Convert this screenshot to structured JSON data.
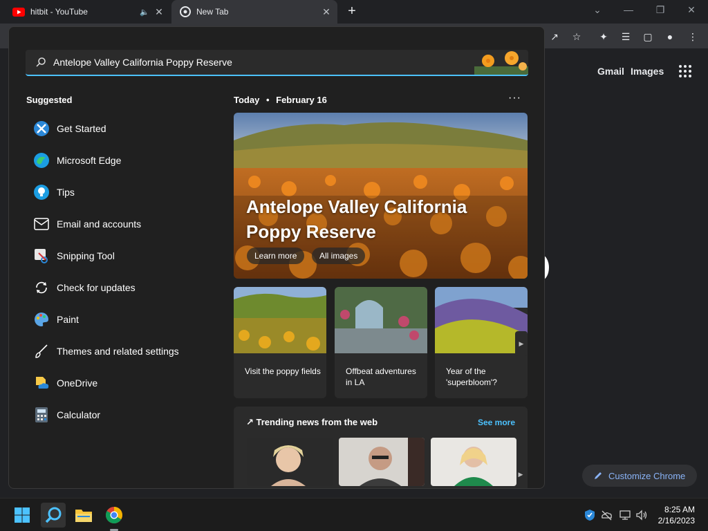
{
  "browser": {
    "tabs": [
      {
        "title": "hitbit - YouTube",
        "icon": "youtube-icon",
        "audio": true
      },
      {
        "title": "New Tab",
        "icon": "chrome-icon"
      }
    ],
    "new_tab_symbol": "+",
    "close_symbol": "✕"
  },
  "google": {
    "gmail": "Gmail",
    "images": "Images",
    "customize": "Customize Chrome"
  },
  "search": {
    "query": "Antelope Valley California Poppy Reserve"
  },
  "suggested": {
    "title": "Suggested",
    "items": [
      {
        "label": "Get Started",
        "icon": "get-started-icon"
      },
      {
        "label": "Microsoft Edge",
        "icon": "edge-icon"
      },
      {
        "label": "Tips",
        "icon": "tips-icon"
      },
      {
        "label": "Email and accounts",
        "icon": "email-icon"
      },
      {
        "label": "Snipping Tool",
        "icon": "snipping-tool-icon"
      },
      {
        "label": "Check for updates",
        "icon": "update-icon"
      },
      {
        "label": "Paint",
        "icon": "paint-icon"
      },
      {
        "label": "Themes and related settings",
        "icon": "brush-icon"
      },
      {
        "label": "OneDrive",
        "icon": "onedrive-icon"
      },
      {
        "label": "Calculator",
        "icon": "calculator-icon"
      }
    ]
  },
  "today": {
    "label": "Today",
    "separator": "•",
    "date": "February 16",
    "more": "···",
    "hero": {
      "title": "Antelope Valley California Poppy Reserve",
      "learn_more": "Learn more",
      "all_images": "All images"
    },
    "cards": [
      {
        "caption": "Visit the poppy fields"
      },
      {
        "caption": "Offbeat adventures in LA"
      },
      {
        "caption": "Year of the 'superbloom'?"
      }
    ]
  },
  "trending": {
    "title": "Trending news from the web",
    "see_more": "See more"
  },
  "taskbar": {
    "time": "8:25 AM",
    "date": "2/16/2023"
  },
  "colors": {
    "accent": "#4cc2ff",
    "panel_bg": "#202020",
    "chrome_bg": "#202124",
    "link_blue": "#8ab4f8"
  }
}
